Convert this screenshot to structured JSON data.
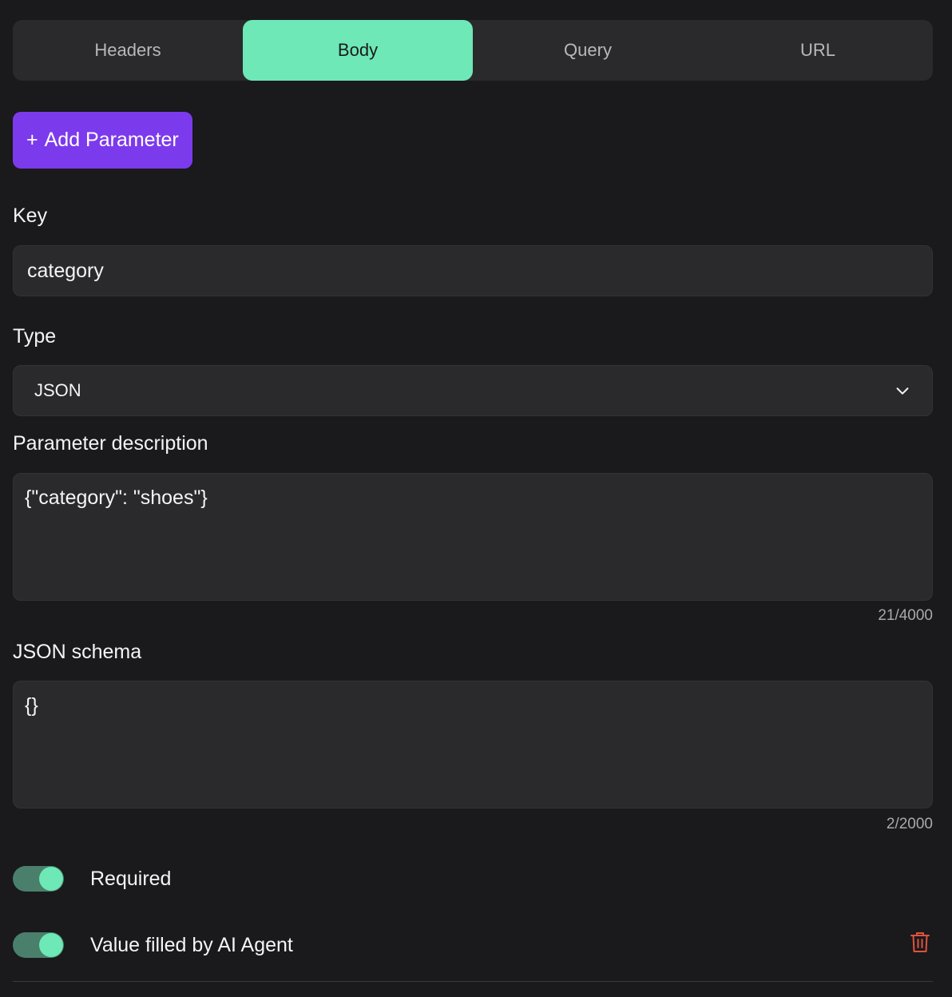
{
  "tabs": [
    {
      "label": "Headers",
      "active": false
    },
    {
      "label": "Body",
      "active": true
    },
    {
      "label": "Query",
      "active": false
    },
    {
      "label": "URL",
      "active": false
    }
  ],
  "add_button": {
    "icon": "+",
    "label": "Add Parameter"
  },
  "key": {
    "label": "Key",
    "value": "category"
  },
  "type": {
    "label": "Type",
    "value": "JSON",
    "icon": "chevron-down-icon"
  },
  "description": {
    "label": "Parameter description",
    "value": "{\"category\": \"shoes\"}",
    "counter": "21/4000"
  },
  "schema": {
    "label": "JSON schema",
    "value": "{}",
    "counter": "2/2000"
  },
  "toggles": {
    "required": {
      "label": "Required",
      "on": true
    },
    "ai_filled": {
      "label": "Value filled by AI Agent",
      "on": true
    }
  },
  "colors": {
    "background": "#1a191c",
    "surface": "#2a2a2d",
    "accent_green": "#6de8b6",
    "accent_purple": "#7c3aed",
    "danger": "#e0533d"
  },
  "icons": {
    "delete": "trash-icon"
  }
}
